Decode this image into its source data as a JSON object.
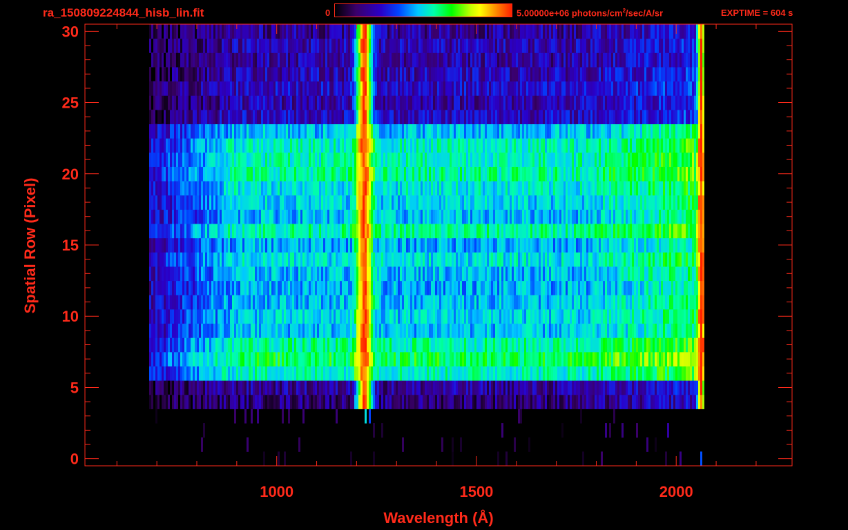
{
  "header": {
    "file_title": "ra_150809224844_hisb_lin.fit",
    "colorbar_min": "0",
    "colorbar_max_text": "5.00000e+06 photons/cm",
    "colorbar_max_exp": "2",
    "colorbar_max_unit": "/sec/A/sr",
    "exptime": "EXPTIME = 604 s"
  },
  "colors": {
    "axis": "#ff2a1a",
    "background": "#000000",
    "colormap": [
      "#000000",
      "#3a006a",
      "#2a00c8",
      "#0044ff",
      "#00c8ff",
      "#00ffaa",
      "#00ff00",
      "#c8ff00",
      "#ffff00",
      "#ff8000",
      "#ff2000"
    ]
  },
  "chart_data": {
    "type": "heatmap",
    "title": "ra_150809224844_hisb_lin.fit",
    "xlabel": "Wavelength (Å)",
    "ylabel": "Spatial Row (Pixel)",
    "xlim": [
      520,
      2290
    ],
    "ylim": [
      -0.5,
      30.5
    ],
    "xticks": [
      1000,
      1500,
      2000
    ],
    "yticks": [
      0,
      5,
      10,
      15,
      20,
      25,
      30
    ],
    "xtick_labels": [
      "1000",
      "1500",
      "2000"
    ],
    "ytick_labels": [
      "0",
      "5",
      "10",
      "15",
      "20",
      "25",
      "30"
    ],
    "colorbar_range": [
      0,
      5000000
    ],
    "grid": false,
    "rows": [
      {
        "row": 0,
        "level": 0.0
      },
      {
        "row": 1,
        "level": 0.02
      },
      {
        "row": 2,
        "level": 0.03
      },
      {
        "row": 3,
        "level": 0.05
      },
      {
        "row": 4,
        "level": 0.12
      },
      {
        "row": 5,
        "level": 0.15
      },
      {
        "row": 6,
        "level": 0.48
      },
      {
        "row": 7,
        "level": 0.56
      },
      {
        "row": 8,
        "level": 0.5
      },
      {
        "row": 9,
        "level": 0.4
      },
      {
        "row": 10,
        "level": 0.42
      },
      {
        "row": 11,
        "level": 0.4
      },
      {
        "row": 12,
        "level": 0.38
      },
      {
        "row": 13,
        "level": 0.4
      },
      {
        "row": 14,
        "level": 0.44
      },
      {
        "row": 15,
        "level": 0.38
      },
      {
        "row": 16,
        "level": 0.5
      },
      {
        "row": 17,
        "level": 0.4
      },
      {
        "row": 18,
        "level": 0.42
      },
      {
        "row": 19,
        "level": 0.45
      },
      {
        "row": 20,
        "level": 0.5
      },
      {
        "row": 21,
        "level": 0.48
      },
      {
        "row": 22,
        "level": 0.47
      },
      {
        "row": 23,
        "level": 0.4
      },
      {
        "row": 24,
        "level": 0.2
      },
      {
        "row": 25,
        "level": 0.17
      },
      {
        "row": 26,
        "level": 0.2
      },
      {
        "row": 27,
        "level": 0.18
      },
      {
        "row": 28,
        "level": 0.16
      },
      {
        "row": 29,
        "level": 0.18
      },
      {
        "row": 30,
        "level": 0.15
      }
    ],
    "features": [
      {
        "name": "Lyman-alpha",
        "wavelength": 1216,
        "width": 18,
        "peak_level": 0.97
      },
      {
        "name": "red edge",
        "wavelength": 2060,
        "width": 8,
        "peak_level": 0.88
      }
    ],
    "signal_range": [
      680,
      2070
    ]
  }
}
